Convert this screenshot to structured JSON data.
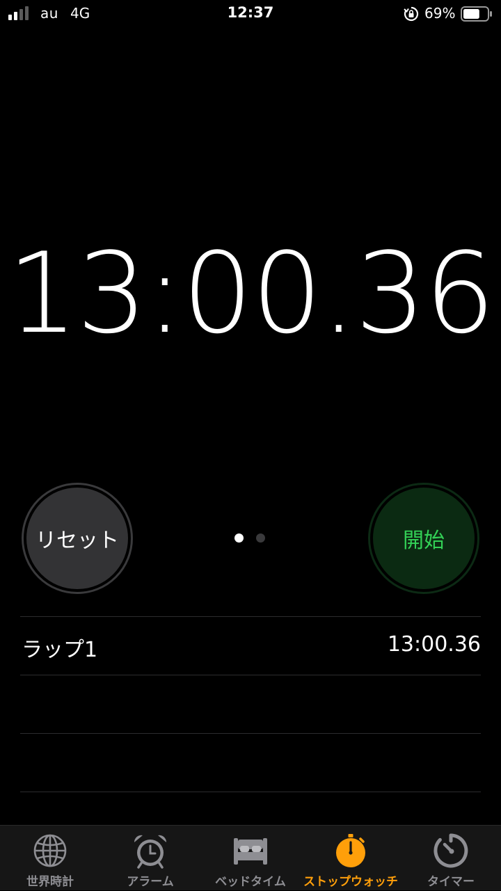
{
  "status_bar": {
    "carrier": "au",
    "network": "4G",
    "time": "12:37",
    "battery_percent": "69%",
    "battery_level": 0.69
  },
  "stopwatch": {
    "display": "13:00.36"
  },
  "buttons": {
    "reset_label": "リセット",
    "start_label": "開始"
  },
  "page_indicator": {
    "count": 2,
    "active_index": 0
  },
  "laps": [
    {
      "label": "ラップ1",
      "time": "13:00.36"
    }
  ],
  "tabs": [
    {
      "label": "世界時計",
      "icon": "globe-icon",
      "active": false
    },
    {
      "label": "アラーム",
      "icon": "alarm-clock-icon",
      "active": false
    },
    {
      "label": "ベッドタイム",
      "icon": "bed-icon",
      "active": false
    },
    {
      "label": "ストップウォッチ",
      "icon": "stopwatch-icon",
      "active": true
    },
    {
      "label": "タイマー",
      "icon": "timer-icon",
      "active": false
    }
  ],
  "colors": {
    "accent": "#ff9f0a",
    "start_green": "#33d156",
    "inactive_tab": "#8e8e93"
  }
}
